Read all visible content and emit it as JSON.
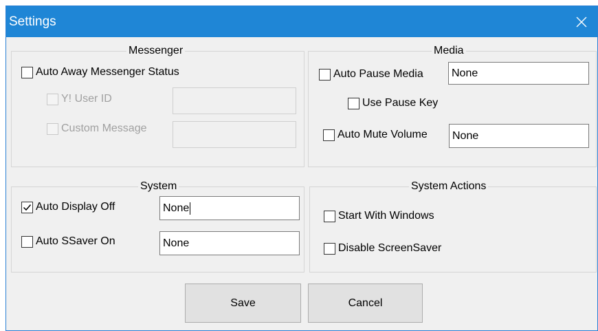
{
  "window": {
    "title": "Settings",
    "close_icon": "close-icon"
  },
  "messenger": {
    "legend": "Messenger",
    "auto_away": {
      "label": "Auto Away Messenger Status",
      "checked": false
    },
    "user_id": {
      "label": "Y! User ID",
      "checked": false,
      "enabled": false,
      "value": ""
    },
    "custom_message": {
      "label": "Custom Message",
      "checked": false,
      "enabled": false,
      "value": ""
    }
  },
  "media": {
    "legend": "Media",
    "auto_pause": {
      "label": "Auto Pause Media",
      "checked": false,
      "value": "None"
    },
    "use_pause_key": {
      "label": "Use Pause Key",
      "checked": false
    },
    "auto_mute": {
      "label": "Auto Mute Volume",
      "checked": false,
      "value": "None"
    }
  },
  "system": {
    "legend": "System",
    "auto_display_off": {
      "label": "Auto Display Off",
      "checked": true,
      "value": "None"
    },
    "auto_ssaver_on": {
      "label": "Auto SSaver On",
      "checked": false,
      "value": "None"
    }
  },
  "system_actions": {
    "legend": "System Actions",
    "start_with_windows": {
      "label": "Start With Windows",
      "checked": false
    },
    "disable_screensaver": {
      "label": "Disable ScreenSaver",
      "checked": false
    }
  },
  "buttons": {
    "save": "Save",
    "cancel": "Cancel"
  }
}
